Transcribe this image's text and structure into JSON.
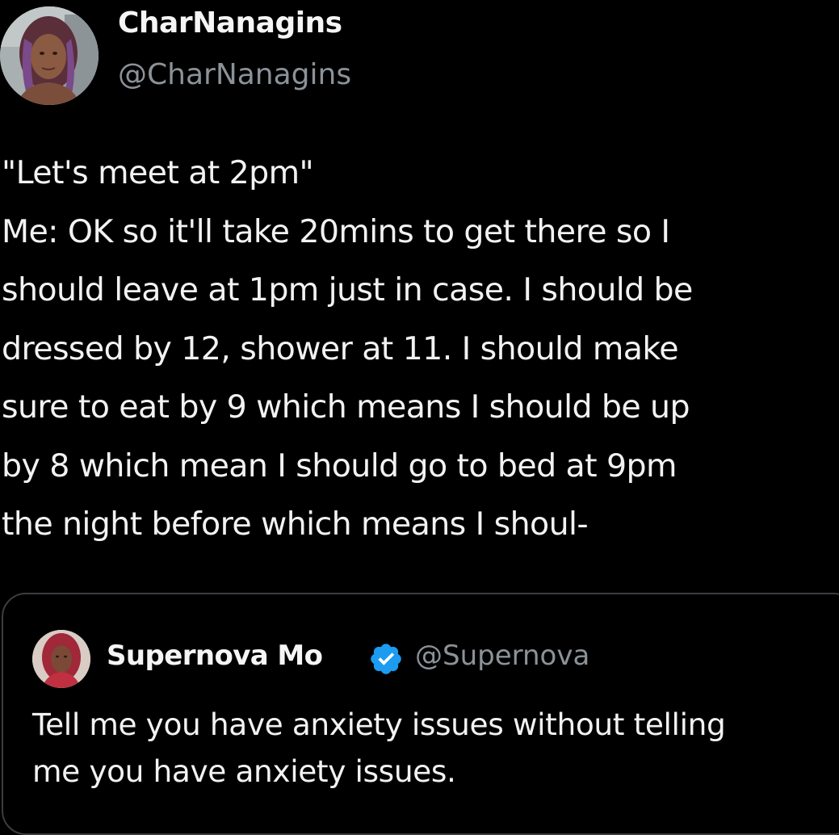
{
  "author": {
    "display_name": "CharNanagins",
    "handle": "@CharNanagins",
    "avatar_icon": "profile-photo"
  },
  "tweet": {
    "lines": [
      "\"Let's meet at 2pm\"",
      "Me: OK so it'll take 20mins to get there so I",
      "should leave at 1pm just in case. I should be",
      "dressed by 12, shower at 11. I should make",
      "sure to eat by 9 which means I should be up",
      "by 8 which mean I should go to bed at 9pm",
      "the night before which means I shoul-"
    ]
  },
  "quoted_tweet": {
    "display_name": "Supernova Mo",
    "handle": "@Supernova",
    "verified_icon": "verified-badge-icon",
    "lines": [
      "Tell me you have anxiety issues without telling",
      "me you have anxiety issues."
    ]
  },
  "colors": {
    "background": "#000000",
    "text": "#e7e9ea",
    "secondary_text": "#8b9298",
    "border": "#3a3d40",
    "verified": "#1d9bf0"
  }
}
